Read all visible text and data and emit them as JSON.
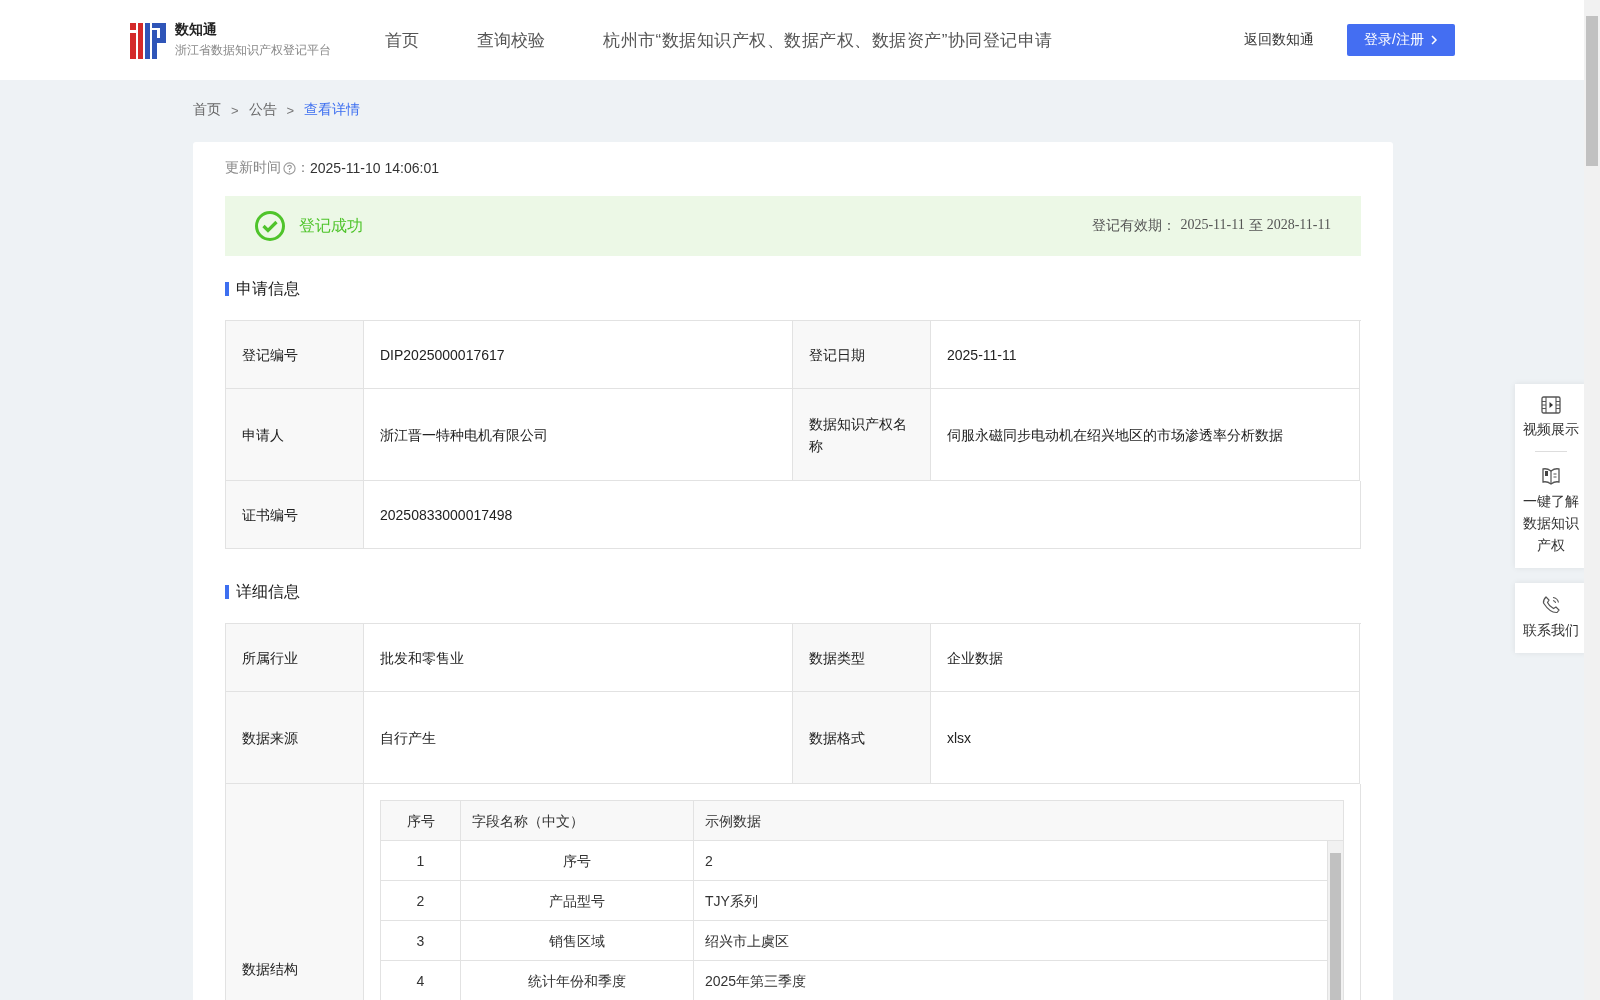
{
  "header": {
    "brand": {
      "name": "数知通",
      "subtitle": "浙江省数据知识产权登记平台"
    },
    "nav": [
      {
        "label": "首页",
        "selected": false
      },
      {
        "label": "查询校验",
        "selected": false
      },
      {
        "label": "杭州市“数据知识产权、数据产权、数据资产”协同登记申请",
        "selected": false
      }
    ],
    "back_link": "返回数知通",
    "login_button": "登录/注册"
  },
  "breadcrumb": [
    {
      "label": "首页",
      "selected": false
    },
    {
      "separator": ">",
      "label": "公告",
      "selected": false
    },
    {
      "separator": ">",
      "label": "查看详情",
      "selected": true
    }
  ],
  "update_time": {
    "label": "更新时间",
    "colon": "：",
    "value": "2025-11-10 14:06:01"
  },
  "status_banner": {
    "kind": "success",
    "text": "登记成功",
    "validity_label": "登记有效期：",
    "validity_from": "2025-11-11",
    "validity_sep": "至",
    "validity_to": "2028-11-11"
  },
  "sections": [
    {
      "title": "申请信息",
      "rows": [
        [
          {
            "label": "登记编号",
            "value": "DIP2025000017617"
          },
          {
            "label": "登记日期",
            "value": "2025-11-11"
          }
        ],
        [
          {
            "label": "申请人",
            "value": "浙江晋一特种电机有限公司"
          },
          {
            "label": "数据知识产权名称",
            "value": "伺服永磁同步电动机在绍兴地区的市场渗透率分析数据"
          }
        ],
        [
          {
            "label": "证书编号",
            "value": "20250833000017498"
          }
        ]
      ]
    },
    {
      "title": "详细信息",
      "rows": [
        [
          {
            "label": "所属行业",
            "value": "批发和零售业"
          },
          {
            "label": "数据类型",
            "value": "企业数据"
          }
        ],
        [
          {
            "label": "数据来源",
            "value": "自行产生"
          },
          {
            "label": "数据格式",
            "value": "xlsx"
          }
        ]
      ],
      "structure": {
        "label": "数据结构",
        "columns": [
          "序号",
          "字段名称（中文）",
          "示例数据"
        ],
        "rows": [
          [
            "1",
            "序号",
            "2"
          ],
          [
            "2",
            "产品型号",
            "TJY系列"
          ],
          [
            "3",
            "销售区域",
            "绍兴市上虞区"
          ],
          [
            "4",
            "统计年份和季度",
            "2025年第三季度"
          ]
        ]
      }
    }
  ],
  "side_panel": [
    {
      "kind": "video",
      "label": "视频展示"
    },
    {
      "kind": "book",
      "label": "一键了解数据知识产权"
    },
    {
      "kind": "phone",
      "label": "联系我们"
    }
  ]
}
